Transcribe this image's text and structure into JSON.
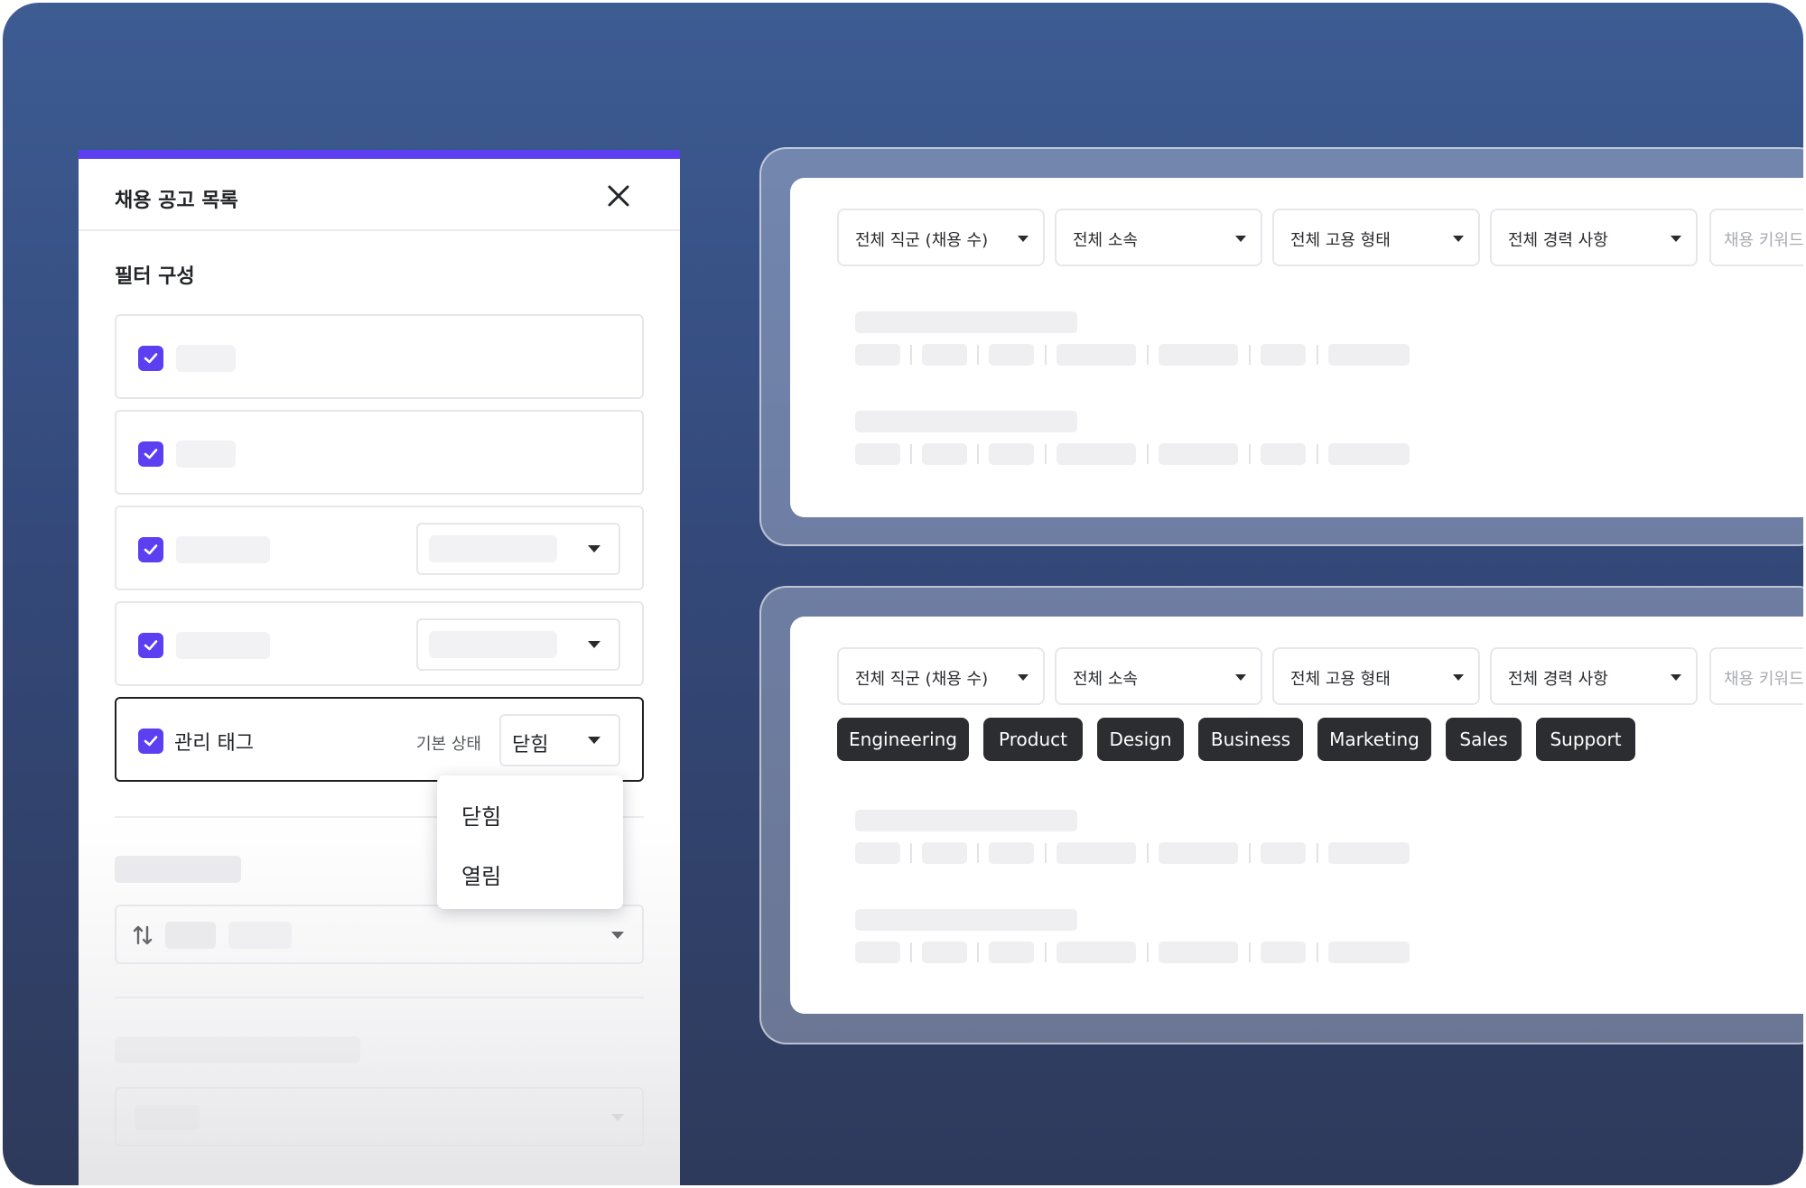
{
  "panel": {
    "title": "채용 공고 목록",
    "section_title": "필터 구성",
    "tag_row": {
      "label": "관리 태그",
      "state_label": "기본 상태",
      "state_value": "닫힘"
    },
    "dropdown_options": [
      "닫힘",
      "열림"
    ]
  },
  "preview": {
    "selects": [
      "전체 직군 (채용 수)",
      "전체 소속",
      "전체 고용 형태",
      "전체 경력 사항"
    ],
    "keyword_placeholder": "채용 키워드",
    "tags": [
      "Engineering",
      "Product",
      "Design",
      "Business",
      "Marketing",
      "Sales",
      "Support"
    ]
  },
  "colors": {
    "accent": "#5b3ff0",
    "tag_bg": "#2b2d31",
    "background_top": "#3d5c93",
    "background_bottom": "#2e3a5b"
  }
}
